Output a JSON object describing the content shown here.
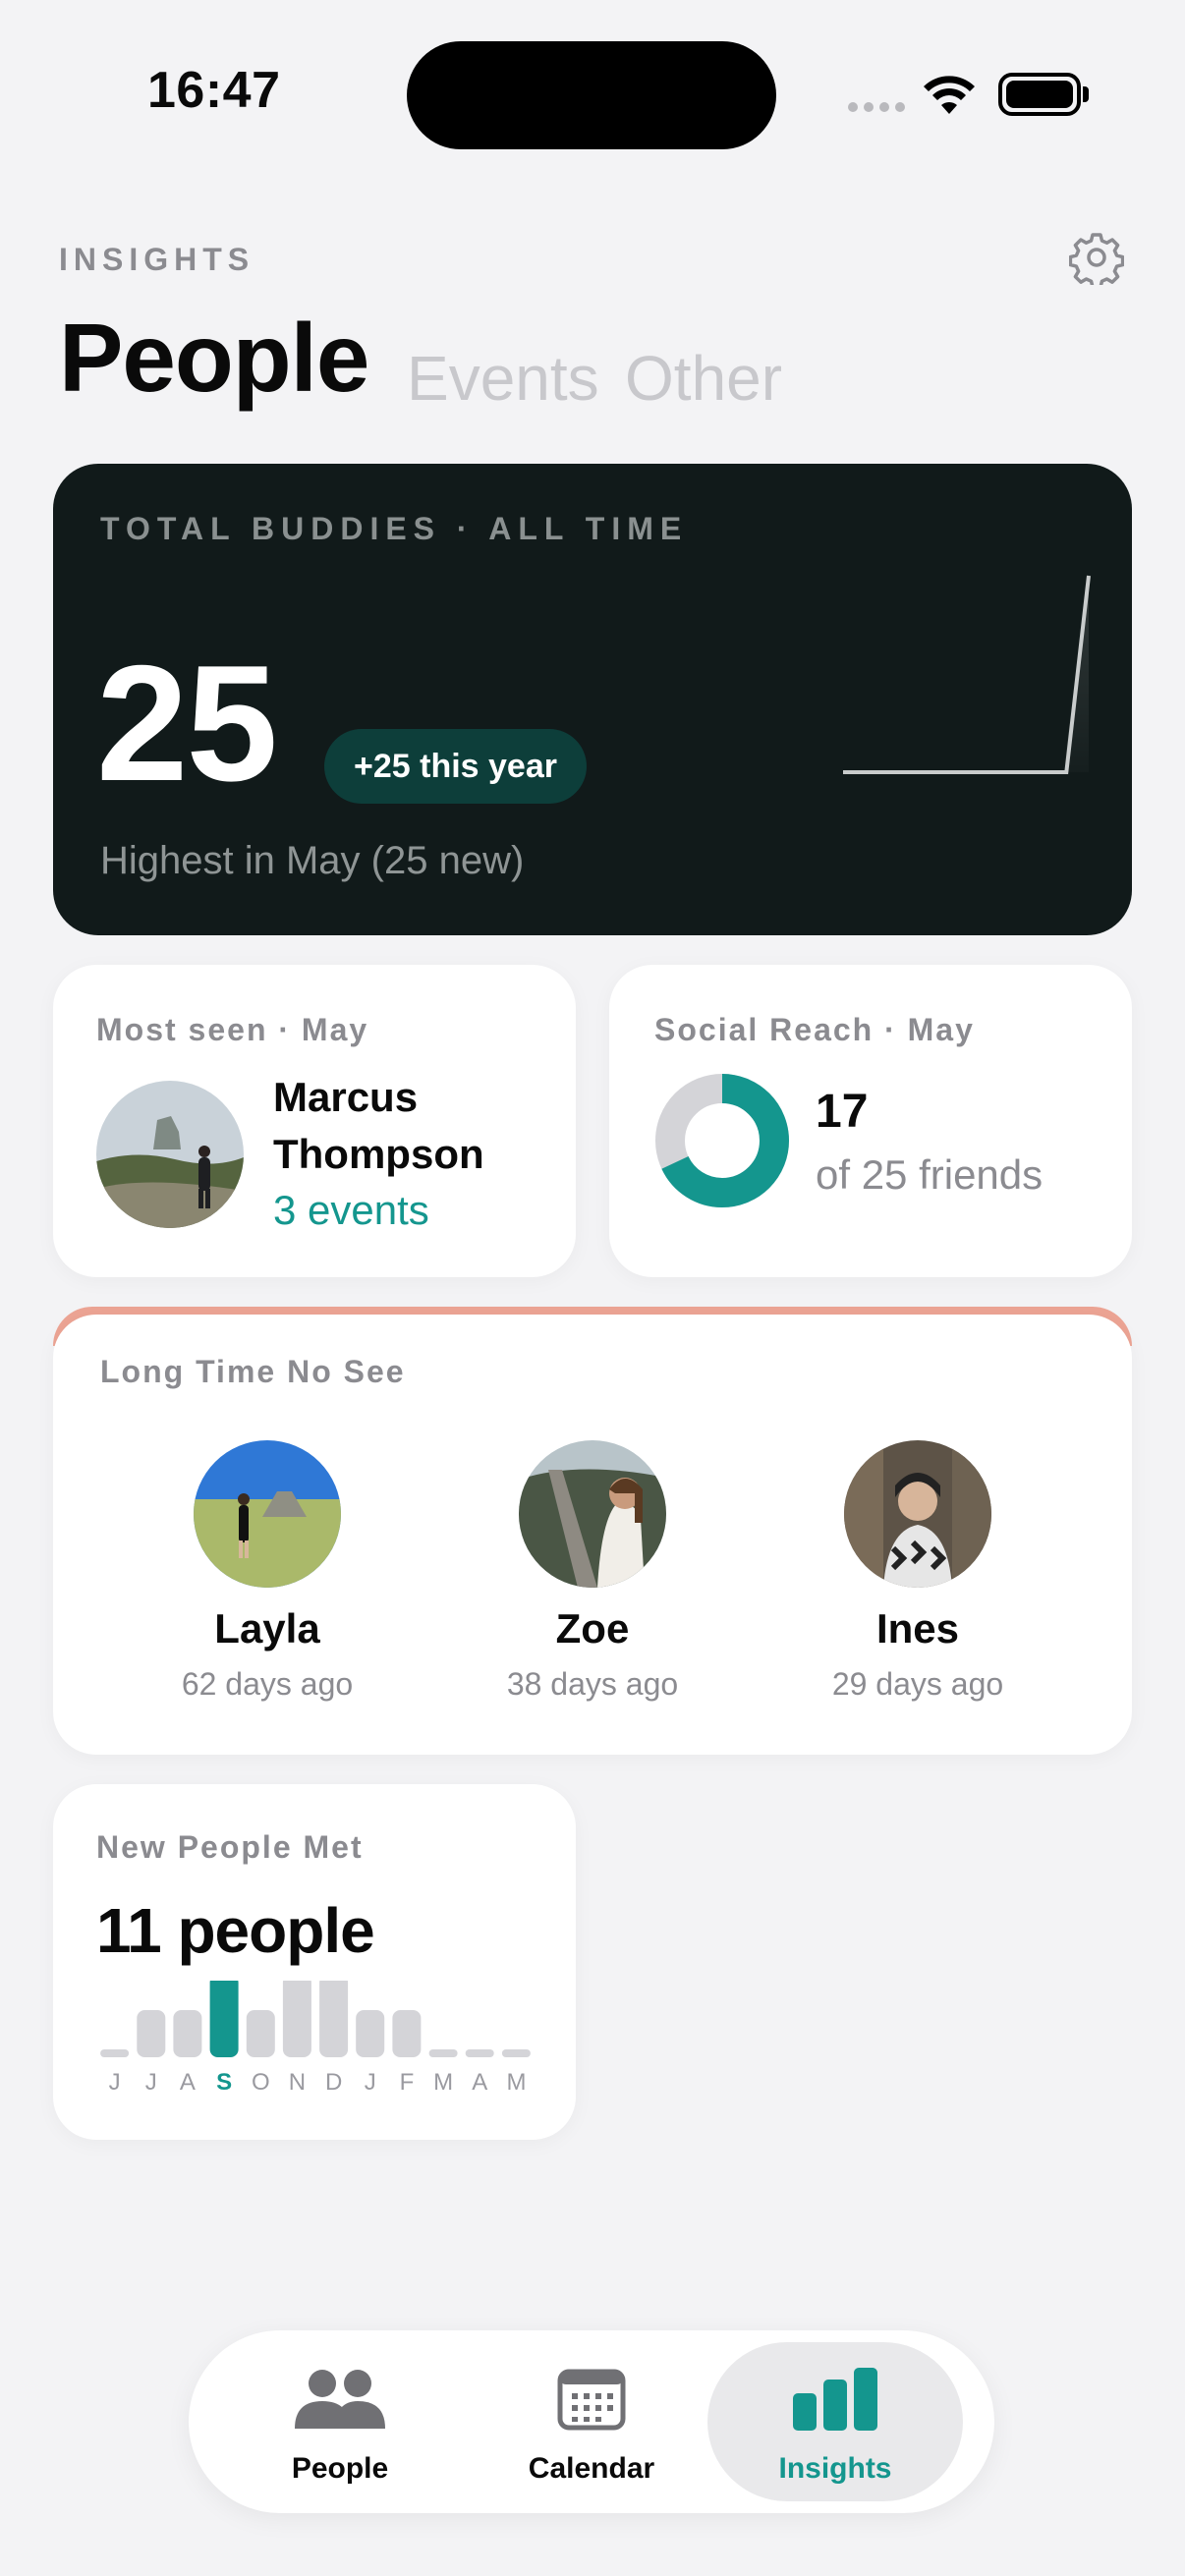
{
  "status": {
    "time": "16:47"
  },
  "header": {
    "eyebrow": "INSIGHTS",
    "tabs": [
      {
        "label": "People",
        "active": true
      },
      {
        "label": "Events",
        "active": false
      },
      {
        "label": "Other",
        "active": false
      }
    ]
  },
  "hero": {
    "label": "TOTAL BUDDIES · ALL TIME",
    "total": "25",
    "pill": "+25 this year",
    "subtitle": "Highest in May (25 new)",
    "sparkline": [
      0,
      0,
      0,
      0,
      0,
      0,
      0,
      0,
      0,
      0,
      0,
      25
    ]
  },
  "most_seen": {
    "label": "Most seen · May",
    "name_line1": "Marcus",
    "name_line2": "Thompson",
    "events": "3 events"
  },
  "social_reach": {
    "label": "Social Reach · May",
    "value": "17",
    "of_text": "of 25 friends",
    "fraction": 0.68
  },
  "long_time_no_see": {
    "label": "Long Time No See",
    "people": [
      {
        "name": "Layla",
        "days": "62 days ago"
      },
      {
        "name": "Zoe",
        "days": "38 days ago"
      },
      {
        "name": "Ines",
        "days": "29 days ago"
      }
    ]
  },
  "new_people": {
    "label": "New People Met",
    "count": "11 people",
    "months": [
      "J",
      "J",
      "A",
      "S",
      "O",
      "N",
      "D",
      "J",
      "F",
      "M",
      "A",
      "M"
    ],
    "values": [
      0,
      1,
      1,
      2,
      1,
      2,
      2,
      1,
      1,
      0,
      0,
      0
    ],
    "highlight_index": 3
  },
  "tabbar": {
    "items": [
      {
        "label": "People",
        "icon": "people-icon"
      },
      {
        "label": "Calendar",
        "icon": "calendar-icon"
      },
      {
        "label": "Insights",
        "icon": "insights-icon"
      }
    ]
  },
  "colors": {
    "accent": "#14968e",
    "hero_bg": "#111a1a",
    "coral": "#eca494"
  }
}
